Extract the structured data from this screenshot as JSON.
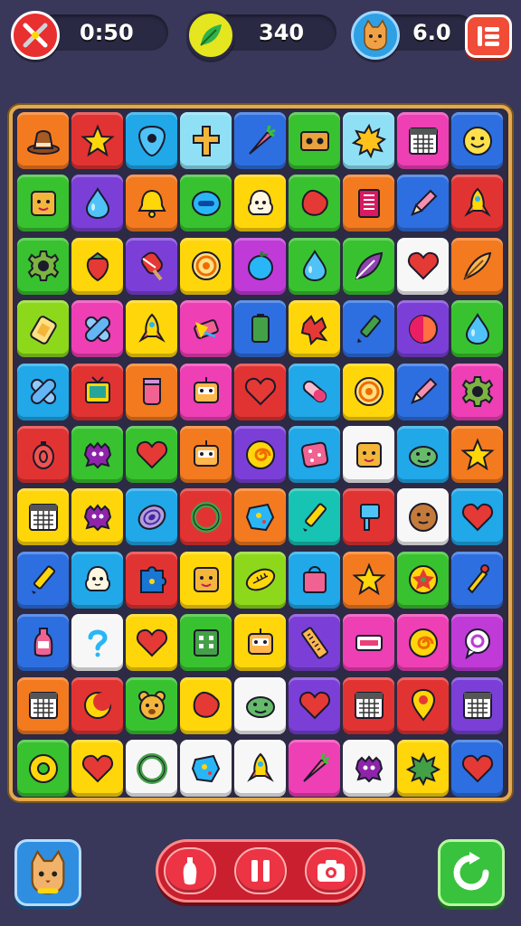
{
  "hud": {
    "timer": {
      "icon": "crossed-swords-icon",
      "value": "0:50"
    },
    "score": {
      "icon": "leaf-icon",
      "value": "340"
    },
    "pet": {
      "icon": "cat-icon",
      "value": "6.0"
    },
    "menu_icon": "menu-icon"
  },
  "colors": {
    "orange": "#f47a1f",
    "red": "#e23333",
    "cyan": "#20a8e8",
    "lightcyan": "#8fe0f5",
    "blue": "#2d6fe0",
    "green": "#39c22f",
    "lime": "#8ed81c",
    "yellow": "#ffd60a",
    "pink": "#ee3fb4",
    "magenta": "#c03ad8",
    "purple": "#7b3fd8",
    "white": "#f7f7f7",
    "teal": "#17c3b2",
    "tan": "#f4a23a"
  },
  "board": {
    "rows": 11,
    "cols": 9,
    "tiles": [
      [
        "orange",
        "hat-icon"
      ],
      [
        "red",
        "star-icon"
      ],
      [
        "cyan",
        "guitar-pick-icon"
      ],
      [
        "lightcyan",
        "cross-icon"
      ],
      [
        "blue",
        "carrot-icon"
      ],
      [
        "green",
        "cassette-icon"
      ],
      [
        "lightcyan",
        "sun-icon"
      ],
      [
        "pink",
        "calendar-icon"
      ],
      [
        "blue",
        "smiley-icon"
      ],
      [
        "green",
        "box-face-icon"
      ],
      [
        "purple",
        "drop-icon"
      ],
      [
        "orange",
        "bell-icon"
      ],
      [
        "green",
        "button-icon"
      ],
      [
        "yellow",
        "ghost-face-icon"
      ],
      [
        "green",
        "blob-icon"
      ],
      [
        "orange",
        "book-icon"
      ],
      [
        "blue",
        "pencil-icon"
      ],
      [
        "red",
        "rocket-icon"
      ],
      [
        "green",
        "gear-icon"
      ],
      [
        "yellow",
        "strawberry-icon"
      ],
      [
        "purple",
        "popsicle-icon"
      ],
      [
        "yellow",
        "target-icon"
      ],
      [
        "magenta",
        "apple-icon"
      ],
      [
        "green",
        "drop-icon"
      ],
      [
        "green",
        "leaf-icon"
      ],
      [
        "white",
        "heart-icon"
      ],
      [
        "orange",
        "feather-icon"
      ],
      [
        "lime",
        "tag-icon"
      ],
      [
        "pink",
        "bandage-icon"
      ],
      [
        "yellow",
        "rocket-icon"
      ],
      [
        "pink",
        "candy-icon"
      ],
      [
        "blue",
        "battery-icon"
      ],
      [
        "yellow",
        "flame-icon"
      ],
      [
        "blue",
        "marker-icon"
      ],
      [
        "purple",
        "ball-icon"
      ],
      [
        "green",
        "drop-icon"
      ],
      [
        "cyan",
        "bandage-icon"
      ],
      [
        "red",
        "tv-icon"
      ],
      [
        "orange",
        "cup-icon"
      ],
      [
        "pink",
        "robot-icon"
      ],
      [
        "red",
        "heart-icon"
      ],
      [
        "cyan",
        "capsule-icon"
      ],
      [
        "yellow",
        "target-icon"
      ],
      [
        "blue",
        "pencil-icon"
      ],
      [
        "pink",
        "gear-icon"
      ],
      [
        "red",
        "bomb-icon"
      ],
      [
        "green",
        "monster-icon"
      ],
      [
        "green",
        "heart-icon"
      ],
      [
        "orange",
        "robot-icon"
      ],
      [
        "purple",
        "spiral-icon"
      ],
      [
        "cyan",
        "sponge-icon"
      ],
      [
        "white",
        "box-face-icon"
      ],
      [
        "cyan",
        "frog-face-icon"
      ],
      [
        "orange",
        "star-icon"
      ],
      [
        "yellow",
        "calendar-icon"
      ],
      [
        "yellow",
        "monster-icon"
      ],
      [
        "cyan",
        "vortex-icon"
      ],
      [
        "red",
        "ring-icon"
      ],
      [
        "orange",
        "gem-icon"
      ],
      [
        "teal",
        "crayon-icon"
      ],
      [
        "red",
        "flag-icon"
      ],
      [
        "white",
        "cookie-icon"
      ],
      [
        "cyan",
        "heart-icon"
      ],
      [
        "blue",
        "crayon-icon"
      ],
      [
        "cyan",
        "ghost-face-icon"
      ],
      [
        "red",
        "puzzle-icon"
      ],
      [
        "yellow",
        "box-face-icon"
      ],
      [
        "lime",
        "football-icon"
      ],
      [
        "cyan",
        "bag-icon"
      ],
      [
        "orange",
        "star-icon"
      ],
      [
        "green",
        "flower-icon"
      ],
      [
        "blue",
        "pen-icon"
      ],
      [
        "blue",
        "bottle-icon"
      ],
      [
        "white",
        "question-icon"
      ],
      [
        "yellow",
        "heart-icon"
      ],
      [
        "green",
        "grid-icon"
      ],
      [
        "yellow",
        "robot-icon"
      ],
      [
        "purple",
        "ruler-icon"
      ],
      [
        "pink",
        "ticket-icon"
      ],
      [
        "pink",
        "spiral-icon"
      ],
      [
        "magenta",
        "chat-icon"
      ],
      [
        "orange",
        "calendar-icon"
      ],
      [
        "red",
        "moon-icon"
      ],
      [
        "green",
        "bear-face-icon"
      ],
      [
        "yellow",
        "blob-icon"
      ],
      [
        "white",
        "frog-face-icon"
      ],
      [
        "purple",
        "heart-icon"
      ],
      [
        "red",
        "calendar-icon"
      ],
      [
        "red",
        "pin-icon"
      ],
      [
        "purple",
        "calendar-icon"
      ],
      [
        "green",
        "donut-icon"
      ],
      [
        "yellow",
        "heart-icon"
      ],
      [
        "white",
        "ring-icon"
      ],
      [
        "white",
        "gem-icon"
      ],
      [
        "white",
        "rocket-icon"
      ],
      [
        "pink",
        "carrot-icon"
      ],
      [
        "white",
        "monster-icon"
      ],
      [
        "yellow",
        "splat-icon"
      ],
      [
        "blue",
        "heart-icon"
      ]
    ]
  },
  "controls": {
    "pet_icon": "cat-icon",
    "buttons": [
      "bottle-icon",
      "pause-icon",
      "camera-icon"
    ],
    "restart_icon": "restart-icon"
  }
}
